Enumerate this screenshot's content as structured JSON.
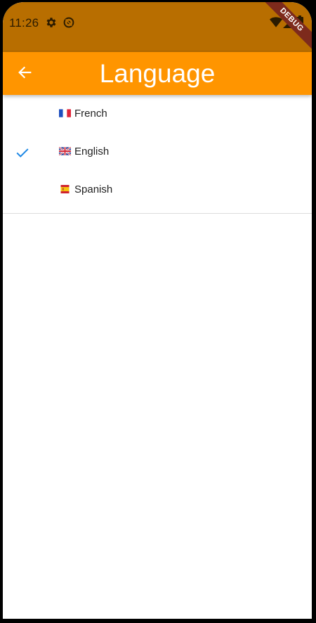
{
  "status_bar": {
    "time": "11:26",
    "icons": [
      "settings-icon",
      "sync-icon",
      "wifi-icon",
      "signal-icon",
      "battery-icon"
    ],
    "debug_banner": "DEBUG"
  },
  "app_bar": {
    "title": "Language",
    "back_icon": "arrow-back-icon"
  },
  "languages": [
    {
      "flag": "france-flag",
      "label": "French",
      "selected": false
    },
    {
      "flag": "uk-flag",
      "label": "English",
      "selected": true
    },
    {
      "flag": "spain-flag",
      "label": "Spanish",
      "selected": false
    }
  ],
  "colors": {
    "status_bar": "#b86e00",
    "app_bar": "#ff9500",
    "check_accent": "#1e88e5"
  }
}
